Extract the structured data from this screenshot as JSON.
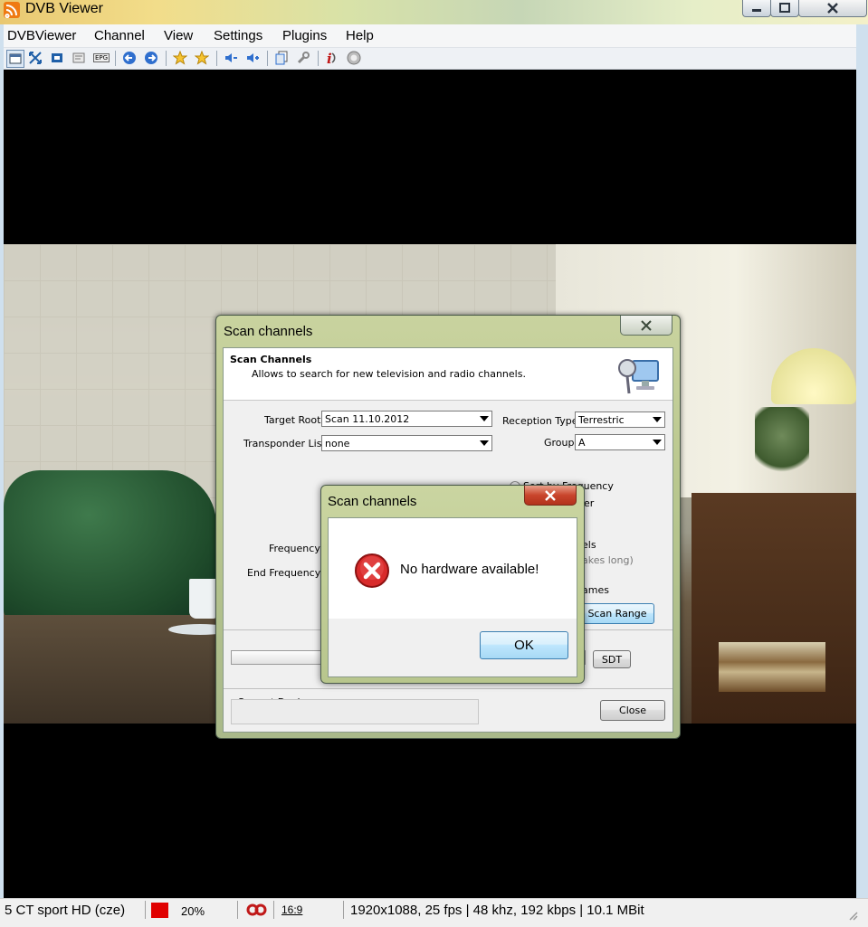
{
  "window": {
    "title": "DVB Viewer"
  },
  "menu": [
    {
      "label": "DVBViewer"
    },
    {
      "label": "Channel"
    },
    {
      "label": "View"
    },
    {
      "label": "Settings"
    },
    {
      "label": "Plugins"
    },
    {
      "label": "Help"
    }
  ],
  "toolbar": {
    "epg_label": "EPG"
  },
  "scan_dialog": {
    "title": "Scan channels",
    "header_title": "Scan Channels",
    "header_desc": "Allows to search for new television and radio channels.",
    "target_root_label": "Target Root",
    "target_root_value": "Scan 11.10.2012",
    "transponder_list_label": "Transponder List",
    "transponder_list_value": "none",
    "reception_type_label": "Reception Type",
    "reception_type_value": "Terrestric",
    "group_label": "Group",
    "group_value": "A",
    "frequency_label": "Frequency",
    "end_frequency_label": "End Frequency",
    "radio_sort_frequency_partial": "Sort by Frequency",
    "radio_second_partial": "er",
    "option_channels_partial": "els",
    "option_takes_long_partial": "akes long)",
    "option_names_partial": "ames",
    "scan_range_label": "Scan Range",
    "sdt_label": "SDT",
    "current_device_label": "Current Device:",
    "close_label": "Close"
  },
  "error_dialog": {
    "title": "Scan channels",
    "message": "No hardware available!",
    "ok_label": "OK"
  },
  "status_bar": {
    "channel": "5 CT sport HD (cze)",
    "signal_percent": "20%",
    "aspect": "16:9",
    "stream_info": "1920x1088, 25 fps | 48 khz, 192 kbps | 10.1 MBit",
    "signal_color": "#e00000"
  }
}
